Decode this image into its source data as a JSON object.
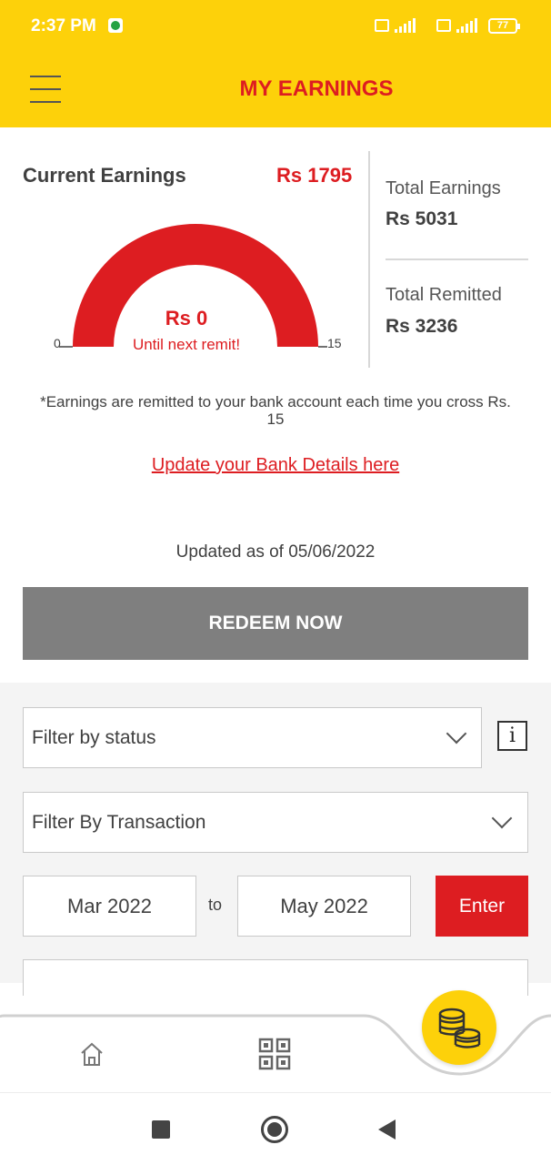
{
  "status_bar": {
    "time": "2:37 PM",
    "battery": "77",
    "icons": [
      "whatsapp-icon",
      "volte-icon",
      "signal-4g-icon",
      "volte-icon",
      "signal-icon",
      "battery-icon"
    ]
  },
  "header": {
    "title": "MY EARNINGS",
    "menu_icon": "hamburger-menu-icon",
    "background_color": "#fdd10a",
    "title_color": "#dd1d21"
  },
  "earnings": {
    "current_label": "Current Earnings",
    "current_value": "Rs 1795",
    "total_earnings_label": "Total Earnings",
    "total_earnings_value": "Rs 5031",
    "total_remitted_label": "Total Remitted",
    "total_remitted_value": "Rs 3236"
  },
  "gauge": {
    "amount": "Rs 0",
    "caption": "Until next remit!",
    "min_label": "0",
    "max_label": "15",
    "fill_fraction": 1.0,
    "color": "#dd1d21"
  },
  "note": "*Earnings are remitted to your bank account each time you cross Rs. 15",
  "bank_link": "Update your Bank Details here",
  "updated": "Updated as of 05/06/2022",
  "redeem_button": "REDEEM NOW",
  "filters": {
    "status_placeholder": "Filter by status",
    "transaction_placeholder": "Filter By Transaction",
    "info_label": "i",
    "date_from": "Mar 2022",
    "date_to_label": "to",
    "date_to": "May 2022",
    "enter_button": "Enter"
  },
  "bottom_nav": {
    "items": [
      "home-icon",
      "qr-code-icon",
      "coins-icon"
    ]
  },
  "system_nav": {
    "items": [
      "recents-square-icon",
      "home-circle-icon",
      "back-triangle-icon"
    ]
  }
}
